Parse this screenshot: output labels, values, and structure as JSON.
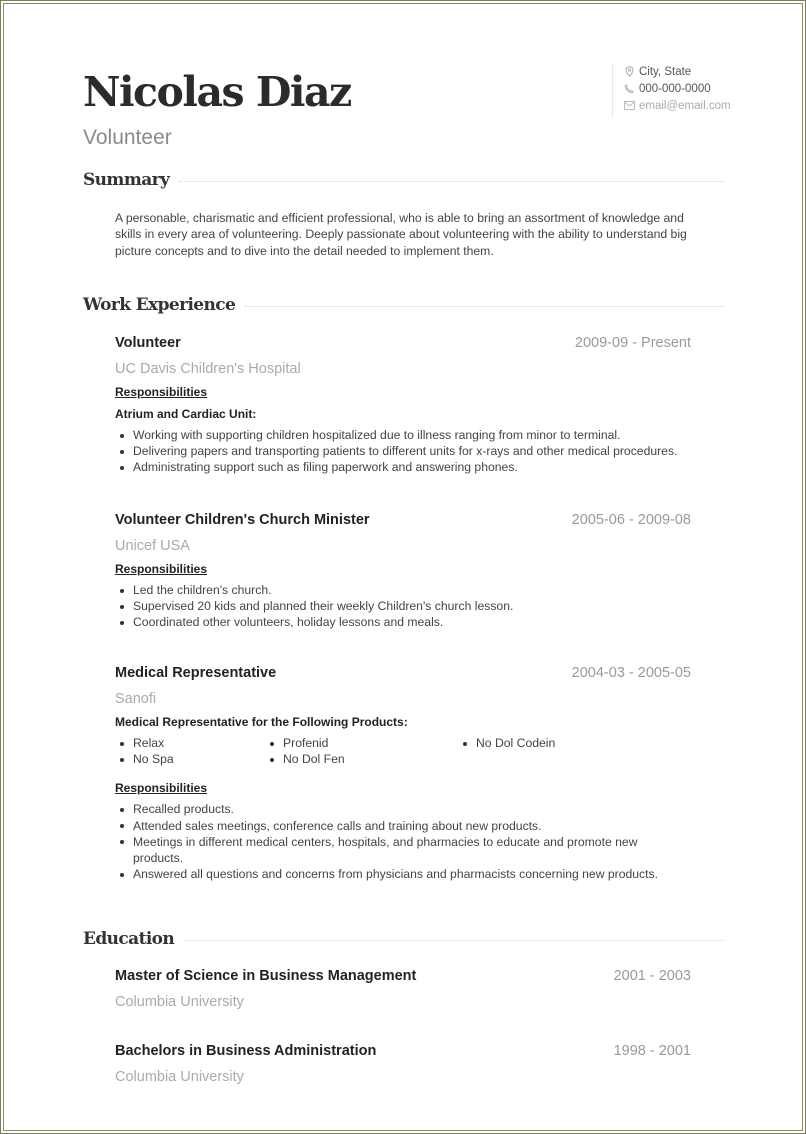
{
  "header": {
    "name": "Nicolas Diaz",
    "title": "Volunteer",
    "contact": {
      "location": "City, State",
      "phone": "000-000-0000",
      "email": "email@email.com"
    }
  },
  "summary": {
    "heading": "Summary",
    "text": "A personable, charismatic and efficient professional, who is able to bring an assortment of knowledge and skills in every area of volunteering. Deeply passionate about volunteering with the ability to understand big picture concepts and to dive into the detail needed to implement them."
  },
  "work": {
    "heading": "Work Experience",
    "jobs": [
      {
        "role": "Volunteer",
        "dates": "2009-09 - Present",
        "org": "UC Davis Children's Hospital",
        "subheading": "Responsibilities",
        "unit": "Atrium and Cardiac Unit:",
        "bullets": [
          "Working with supporting children hospitalized due to illness ranging from minor to terminal.",
          "Delivering papers and transporting patients to different units for x-rays and other medical procedures.",
          "Administrating support such as filing paperwork and answering phones."
        ]
      },
      {
        "role": "Volunteer Children's Church Minister",
        "dates": "2005-06 - 2009-08",
        "org": "Unicef USA",
        "subheading": "Responsibilities",
        "bullets": [
          "Led the children's church.",
          "Supervised 20 kids and planned their weekly Children's church lesson.",
          "Coordinated other volunteers, holiday lessons and meals."
        ]
      },
      {
        "role": "Medical Representative",
        "dates": "2004-03 - 2005-05",
        "org": "Sanofi",
        "products_heading": "Medical Representative for the Following Products:",
        "products": [
          [
            "Relax",
            "No Spa"
          ],
          [
            "Profenid",
            "No Dol Fen"
          ],
          [
            "No Dol Codein"
          ]
        ],
        "subheading": "Responsibilities",
        "bullets": [
          "Recalled products.",
          "Attended sales meetings, conference calls and training about new products.",
          "Meetings in different medical centers, hospitals, and pharmacies to educate and promote new products.",
          "Answered all questions and concerns from physicians and pharmacists concerning new products."
        ]
      }
    ]
  },
  "education": {
    "heading": "Education",
    "items": [
      {
        "degree": "Master of Science in Business Management",
        "dates": "2001 - 2003",
        "school": "Columbia University"
      },
      {
        "degree": "Bachelors in Business Administration",
        "dates": "1998 - 2001",
        "school": "Columbia University"
      }
    ]
  }
}
